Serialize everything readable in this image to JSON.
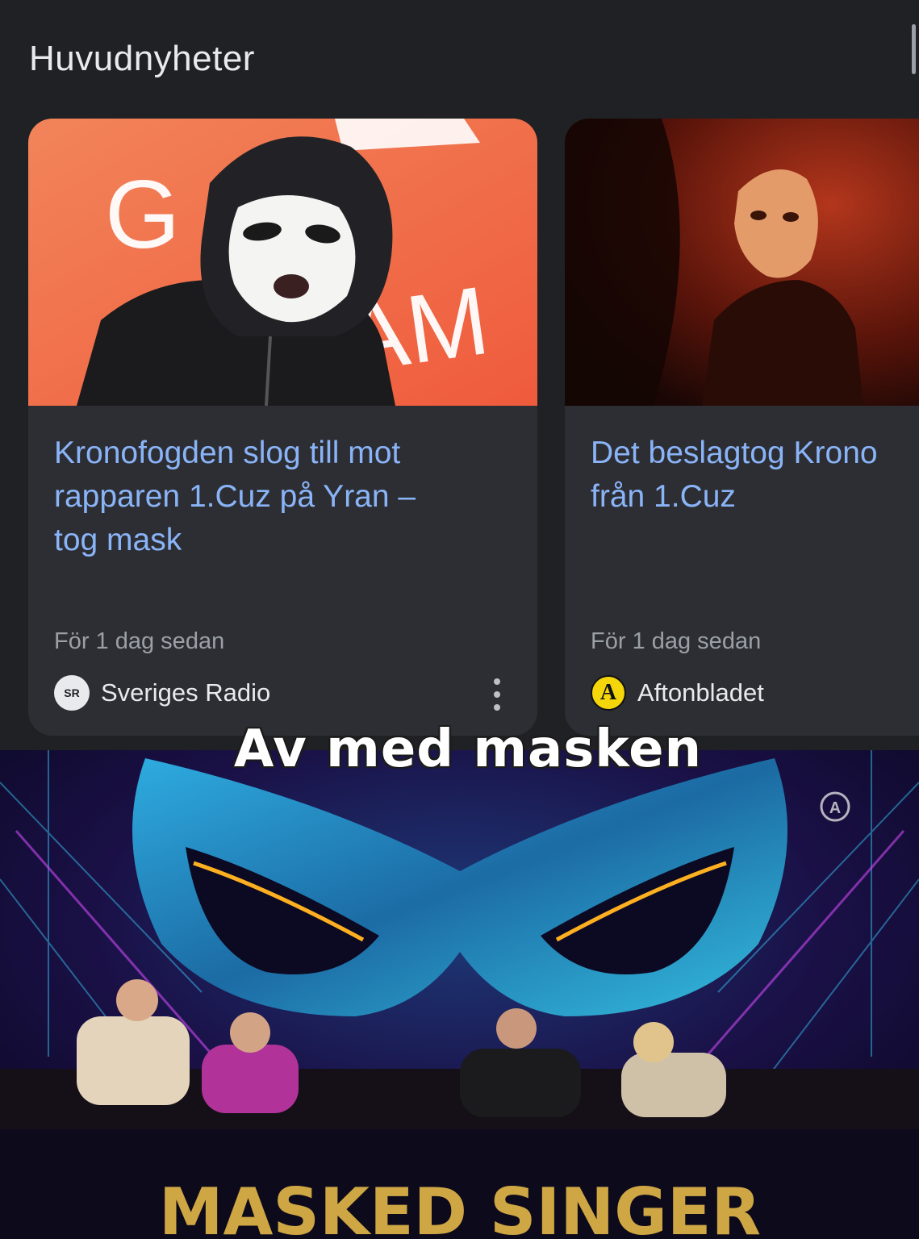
{
  "header": {
    "title": "Huvudnyheter"
  },
  "cards": [
    {
      "headline": "Kronofogden slog till mot\nrapparen 1.Cuz på Yran –\ntog mask",
      "time": "För 1 dag sedan",
      "source": "Sveriges Radio",
      "source_logo_text": "SR",
      "image_text": "GRAM"
    },
    {
      "headline": "Det beslagtog Krono\nfrån 1.Cuz",
      "time": "För 1 dag sedan",
      "source": "Aftonbladet",
      "source_logo_text": "A"
    }
  ],
  "caption": "Av med masken",
  "scene": {
    "channel_logo": "A",
    "stage_sign": "MASKED SINGER"
  }
}
